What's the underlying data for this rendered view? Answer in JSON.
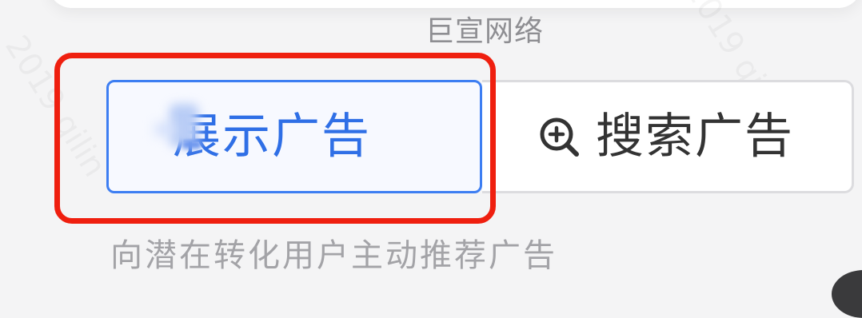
{
  "brand": {
    "name": "巨宣网络"
  },
  "tabs": [
    {
      "label": "展示广告",
      "icon": "display-icon",
      "selected": true
    },
    {
      "label": "搜索广告",
      "icon": "zoom-search-icon",
      "selected": false
    }
  ],
  "subtitle": "向潜在转化用户主动推荐广告",
  "colors": {
    "accent": "#2f6fe6",
    "highlight_frame": "#ef1f0f",
    "muted_text": "#a3a3a7"
  }
}
